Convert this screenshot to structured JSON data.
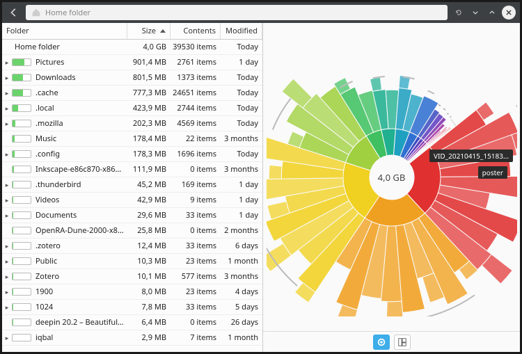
{
  "titlebar": {
    "breadcrumb_label": "Home folder"
  },
  "columns": {
    "folder": "Folder",
    "size": "Size",
    "contents": "Contents",
    "modified": "Modified"
  },
  "root_row": {
    "name": "Home folder",
    "size": "4,0 GB",
    "contents": "39530 items",
    "modified": "Today"
  },
  "rows": [
    {
      "name": "Pictures",
      "size": "901,4 MB",
      "contents": "2761 items",
      "modified": "1 day",
      "expandable": true,
      "bar": 0.65
    },
    {
      "name": "Downloads",
      "size": "801,5 MB",
      "contents": "1373 items",
      "modified": "Today",
      "expandable": true,
      "bar": 0.58
    },
    {
      "name": ".cache",
      "size": "777,3 MB",
      "contents": "24651 items",
      "modified": "Today",
      "expandable": true,
      "bar": 0.56
    },
    {
      "name": ".local",
      "size": "423,9 MB",
      "contents": "2744 items",
      "modified": "Today",
      "expandable": true,
      "bar": 0.31
    },
    {
      "name": ".mozilla",
      "size": "202,3 MB",
      "contents": "4569 items",
      "modified": "Today",
      "expandable": true,
      "bar": 0.15
    },
    {
      "name": "Music",
      "size": "178,4 MB",
      "contents": "22 items",
      "modified": "3 months",
      "expandable": false,
      "bar": 0.13
    },
    {
      "name": ".config",
      "size": "178,3 MB",
      "contents": "1696 items",
      "modified": "Today",
      "expandable": true,
      "bar": 0.13
    },
    {
      "name": "Inkscape-e86c870-x86_6...",
      "size": "111,9 MB",
      "contents": "0 items",
      "modified": "3 months",
      "expandable": false,
      "bar": 0.08
    },
    {
      "name": ".thunderbird",
      "size": "45,2 MB",
      "contents": "169 items",
      "modified": "1 day",
      "expandable": true,
      "bar": 0.03
    },
    {
      "name": "Videos",
      "size": "42,9 MB",
      "contents": "9 items",
      "modified": "1 day",
      "expandable": true,
      "bar": 0.03
    },
    {
      "name": "Documents",
      "size": "29,6 MB",
      "contents": "33 items",
      "modified": "1 day",
      "expandable": true,
      "bar": 0.02
    },
    {
      "name": "OpenRA-Dune-2000-x86_...",
      "size": "25,8 MB",
      "contents": "0 items",
      "modified": "2 months",
      "expandable": false,
      "bar": 0.02
    },
    {
      "name": ".zotero",
      "size": "12,4 MB",
      "contents": "33 items",
      "modified": "6 days",
      "expandable": true,
      "bar": 0.01
    },
    {
      "name": "Public",
      "size": "10,3 MB",
      "contents": "23 items",
      "modified": "1 month",
      "expandable": true,
      "bar": 0.01
    },
    {
      "name": "Zotero",
      "size": "10,1 MB",
      "contents": "577 items",
      "modified": "3 months",
      "expandable": true,
      "bar": 0.01
    },
    {
      "name": "1900",
      "size": "8,0 MB",
      "contents": "23 items",
      "modified": "4 days",
      "expandable": true,
      "bar": 0.006
    },
    {
      "name": "1024",
      "size": "7,8 MB",
      "contents": "33 items",
      "modified": "5 days",
      "expandable": true,
      "bar": 0.006
    },
    {
      "name": "deepin 20.2 – Beautiful a...",
      "size": "6,4 MB",
      "contents": "0 items",
      "modified": "26 days",
      "expandable": false,
      "bar": 0.005
    },
    {
      "name": "iqbal",
      "size": "2,9 MB",
      "contents": "7 items",
      "modified": "1 month",
      "expandable": true,
      "bar": 0.002
    }
  ],
  "chart_data": {
    "type": "sunburst",
    "center_label": "4,0 GB",
    "tooltips": {
      "segment": "VID_20210415_15183...",
      "child": "poster"
    },
    "segments": [
      {
        "name": "Pictures",
        "value": 901.4,
        "color": "#e03030"
      },
      {
        "name": "Downloads",
        "value": 801.5,
        "color": "#f0a020"
      },
      {
        "name": ".cache",
        "value": 777.3,
        "color": "#f0d020"
      },
      {
        "name": ".local",
        "value": 423.9,
        "color": "#a0d040"
      },
      {
        "name": ".mozilla",
        "value": 202.3,
        "color": "#40c060"
      },
      {
        "name": "Music",
        "value": 178.4,
        "color": "#20b090"
      },
      {
        "name": ".config",
        "value": 178.3,
        "color": "#20a0c0"
      },
      {
        "name": "Inkscape",
        "value": 111.9,
        "color": "#3070d0"
      },
      {
        "name": ".thunderbird",
        "value": 45.2,
        "color": "#4050c0"
      },
      {
        "name": "Videos",
        "value": 42.9,
        "color": "#6040c0"
      },
      {
        "name": "Documents",
        "value": 29.6,
        "color": "#8030b0"
      },
      {
        "name": "OpenRA",
        "value": 25.8,
        "color": "#a030a0"
      },
      {
        "name": ".zotero",
        "value": 12.4,
        "color": "#c03090"
      },
      {
        "name": "Public",
        "value": 10.3,
        "color": "#d03070"
      },
      {
        "name": "Zotero",
        "value": 10.1,
        "color": "#e03050"
      },
      {
        "name": "1900",
        "value": 8.0,
        "color": "#e04040"
      },
      {
        "name": "1024",
        "value": 7.8,
        "color": "#e05038"
      },
      {
        "name": "deepin",
        "value": 6.4,
        "color": "#e06030"
      },
      {
        "name": "iqbal",
        "value": 2.9,
        "color": "#e07028"
      }
    ]
  }
}
